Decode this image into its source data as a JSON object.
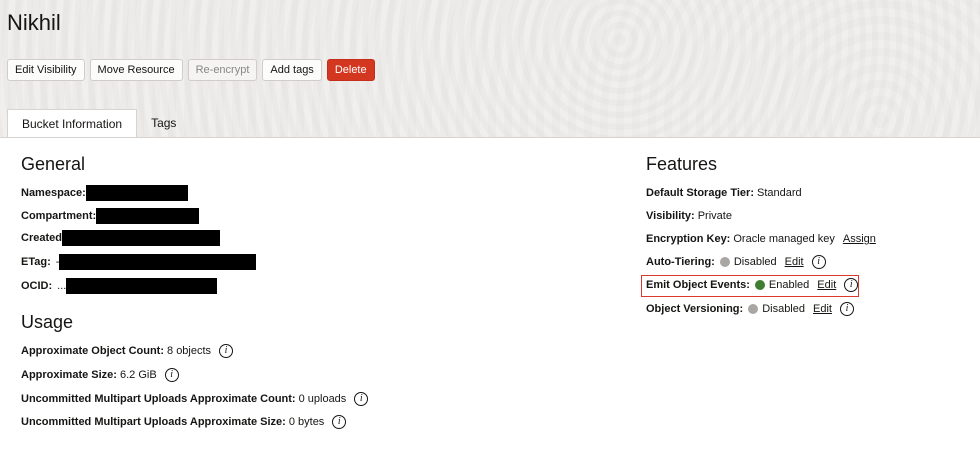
{
  "page": {
    "title": "Nikhil"
  },
  "toolbar": {
    "edit_visibility": "Edit Visibility",
    "move_resource": "Move Resource",
    "re_encrypt": "Re-encrypt",
    "add_tags": "Add tags",
    "delete": "Delete"
  },
  "tabs": [
    {
      "label": "Bucket Information",
      "active": true
    },
    {
      "label": "Tags",
      "active": false
    }
  ],
  "general": {
    "heading": "General",
    "namespace_label": "Namespace:",
    "compartment_label": "Compartment:",
    "created_label": "Created",
    "etag_label": "ETag:",
    "etag_prefix": "-",
    "ocid_label": "OCID:",
    "ocid_prefix": "..."
  },
  "usage": {
    "heading": "Usage",
    "object_count_label": "Approximate Object Count:",
    "object_count_value": "8 objects",
    "size_label": "Approximate Size:",
    "size_value": "6.2 GiB",
    "mp_count_label": "Uncommitted Multipart Uploads Approximate Count:",
    "mp_count_value": "0 uploads",
    "mp_size_label": "Uncommitted Multipart Uploads Approximate Size:",
    "mp_size_value": "0 bytes"
  },
  "features": {
    "heading": "Features",
    "storage_tier_label": "Default Storage Tier:",
    "storage_tier_value": "Standard",
    "visibility_label": "Visibility:",
    "visibility_value": "Private",
    "encryption_label": "Encryption Key:",
    "encryption_value": "Oracle managed key",
    "encryption_link": "Assign",
    "auto_tiering_label": "Auto-Tiering:",
    "auto_tiering_value": "Disabled",
    "emit_events_label": "Emit Object Events:",
    "emit_events_value": "Enabled",
    "versioning_label": "Object Versioning:",
    "versioning_value": "Disabled",
    "edit_link": "Edit"
  },
  "icons": {
    "info": "i"
  },
  "colors": {
    "enabled": "#3f7d32",
    "disabled": "#a9a6a3",
    "danger": "#d4371f",
    "highlight": "#d93a2b"
  }
}
